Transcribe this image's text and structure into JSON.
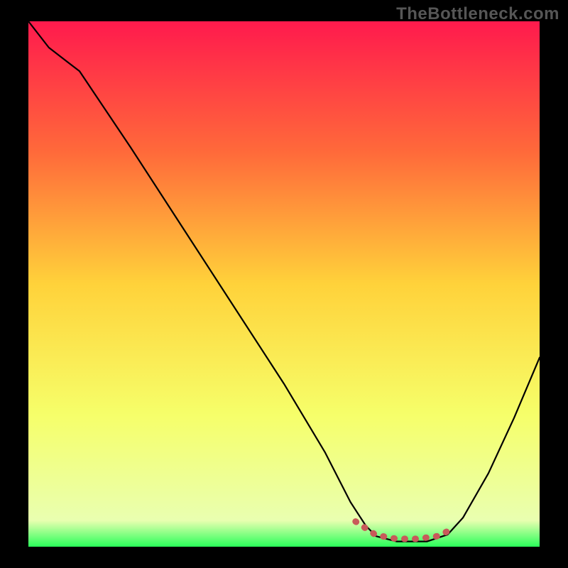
{
  "watermark": "TheBottleneck.com",
  "chart_data": {
    "type": "line",
    "title": "",
    "xlabel": "",
    "ylabel": "",
    "xlim": [
      0,
      100
    ],
    "ylim": [
      0,
      100
    ],
    "gradient_stops": [
      {
        "offset": 0.0,
        "color": "#ff1a4d"
      },
      {
        "offset": 0.25,
        "color": "#ff6a3a"
      },
      {
        "offset": 0.5,
        "color": "#ffd23a"
      },
      {
        "offset": 0.75,
        "color": "#f6ff6a"
      },
      {
        "offset": 0.95,
        "color": "#e9ffb0"
      },
      {
        "offset": 1.0,
        "color": "#2aff5a"
      }
    ],
    "series": [
      {
        "name": "curve",
        "color": "#000000",
        "points": [
          {
            "x": 0.0,
            "y": 100.0
          },
          {
            "x": 4.0,
            "y": 95.0
          },
          {
            "x": 8.0,
            "y": 92.0
          },
          {
            "x": 10.0,
            "y": 90.5
          },
          {
            "x": 20.0,
            "y": 76.0
          },
          {
            "x": 30.0,
            "y": 61.0
          },
          {
            "x": 40.0,
            "y": 46.0
          },
          {
            "x": 50.0,
            "y": 31.0
          },
          {
            "x": 58.0,
            "y": 18.0
          },
          {
            "x": 63.0,
            "y": 8.5
          },
          {
            "x": 66.0,
            "y": 4.0
          },
          {
            "x": 68.0,
            "y": 2.0
          },
          {
            "x": 72.0,
            "y": 1.0
          },
          {
            "x": 78.0,
            "y": 1.0
          },
          {
            "x": 82.0,
            "y": 2.3
          },
          {
            "x": 85.0,
            "y": 5.5
          },
          {
            "x": 90.0,
            "y": 14.0
          },
          {
            "x": 95.0,
            "y": 24.5
          },
          {
            "x": 100.0,
            "y": 36.0
          }
        ]
      },
      {
        "name": "highlight-band",
        "color": "#c85a5a",
        "points": [
          {
            "x": 64.0,
            "y": 4.8
          },
          {
            "x": 68.0,
            "y": 2.2
          },
          {
            "x": 72.0,
            "y": 1.5
          },
          {
            "x": 76.0,
            "y": 1.5
          },
          {
            "x": 80.0,
            "y": 2.0
          },
          {
            "x": 83.0,
            "y": 3.4
          }
        ]
      }
    ]
  }
}
